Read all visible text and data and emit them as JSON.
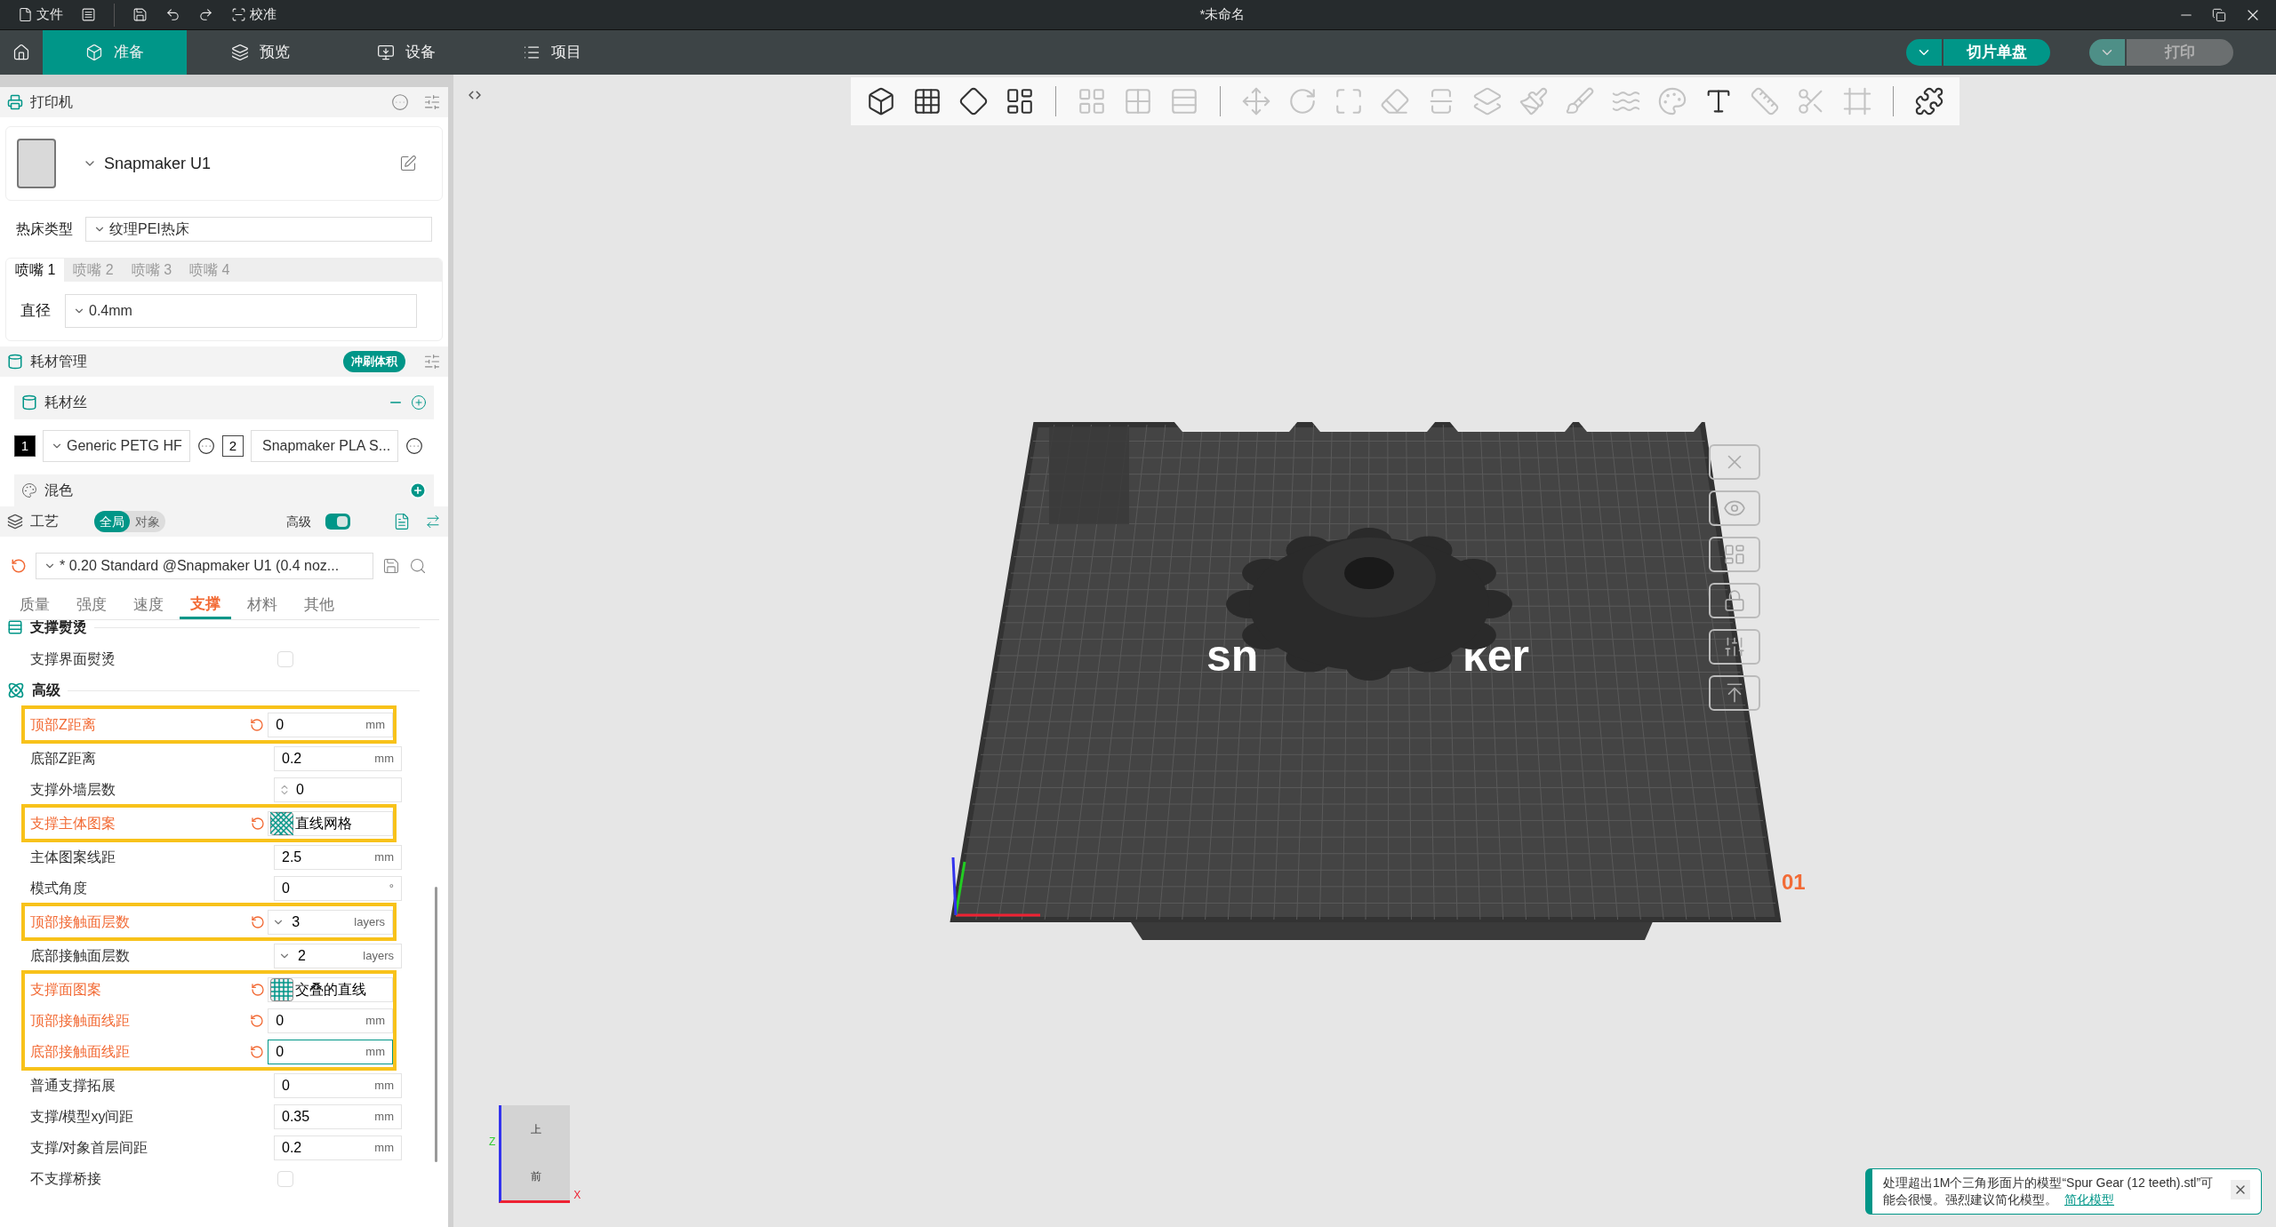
{
  "window": {
    "title": "*未命名",
    "menu": [
      {
        "kind": "file",
        "label": "文件"
      },
      {
        "kind": "menu"
      },
      {
        "kind": "save"
      },
      {
        "kind": "undo"
      },
      {
        "kind": "redo"
      },
      {
        "kind": "calibrate",
        "label": "校准"
      }
    ]
  },
  "tabs": [
    {
      "kind": "home",
      "selected": false
    },
    {
      "kind": "prepare",
      "label": "准备",
      "selected": true
    },
    {
      "kind": "preview",
      "label": "预览",
      "selected": false
    },
    {
      "kind": "device",
      "label": "设备",
      "selected": false
    },
    {
      "kind": "project",
      "label": "项目",
      "selected": false
    }
  ],
  "actions": [
    {
      "label": "切片单盘",
      "disabled": false
    },
    {
      "label": "打印",
      "disabled": true
    }
  ],
  "printer": {
    "title": "打印机",
    "name": "Snapmaker U1",
    "bed_label": "热床类型",
    "bed_value": "纹理PEI热床",
    "nozzles": [
      {
        "label": "喷嘴 1",
        "selected": true
      },
      {
        "label": "喷嘴 2",
        "selected": false
      },
      {
        "label": "喷嘴 3",
        "selected": false
      },
      {
        "label": "喷嘴 4",
        "selected": false
      }
    ],
    "diameter_label": "直径",
    "diameter_value": "0.4mm"
  },
  "filament": {
    "title": "耗材管理",
    "badge": "冲刷体积",
    "list_title": "耗材丝",
    "slots": [
      {
        "number": "1",
        "color": "#000000",
        "name": "Generic PETG HF"
      },
      {
        "number": "2",
        "color": "#ffffff",
        "name": "Snapmaker PLA S..."
      }
    ],
    "mix_title": "混色"
  },
  "process": {
    "title": "工艺",
    "scope": [
      {
        "label": "全局",
        "selected": true
      },
      {
        "label": "对象",
        "selected": false
      }
    ],
    "advanced_label": "高级",
    "advanced_on": true,
    "preset": "* 0.20 Standard @Snapmaker U1 (0.4 noz...",
    "tabs": [
      {
        "label": "质量",
        "selected": false
      },
      {
        "label": "强度",
        "selected": false
      },
      {
        "label": "速度",
        "selected": false
      },
      {
        "label": "支撑",
        "selected": true
      },
      {
        "label": "材料",
        "selected": false
      },
      {
        "label": "其他",
        "selected": false
      }
    ]
  },
  "settings": [
    {
      "kind": "section",
      "label": "支撑熨烫"
    },
    {
      "kind": "checkbox",
      "label": "支撑界面熨烫",
      "checked": false,
      "modified": false
    },
    {
      "kind": "section",
      "label": "高级"
    },
    {
      "kind": "group",
      "rows": [
        {
          "kind": "number",
          "label": "顶部Z距离",
          "value": "0",
          "unit": "mm",
          "modified": true,
          "focused": false
        }
      ]
    },
    {
      "kind": "number",
      "label": "底部Z距离",
      "value": "0.2",
      "unit": "mm",
      "modified": false,
      "focused": false
    },
    {
      "kind": "spin",
      "label": "支撑外墙层数",
      "value": "0",
      "modified": false
    },
    {
      "kind": "group",
      "rows": [
        {
          "kind": "crosspattern",
          "label": "支撑主体图案",
          "value": "直线网格",
          "modified": true
        }
      ]
    },
    {
      "kind": "number",
      "label": "主体图案线距",
      "value": "2.5",
      "unit": "mm",
      "modified": false,
      "focused": false
    },
    {
      "kind": "number",
      "label": "模式角度",
      "value": "0",
      "unit": "°",
      "modified": false,
      "focused": false
    },
    {
      "kind": "group",
      "rows": [
        {
          "kind": "dropdown",
          "label": "顶部接触面层数",
          "value": "3",
          "unit": "layers",
          "modified": true
        }
      ]
    },
    {
      "kind": "dropdown",
      "label": "底部接触面层数",
      "value": "2",
      "unit": "layers",
      "modified": false
    },
    {
      "kind": "group",
      "rows": [
        {
          "kind": "gridpattern",
          "label": "支撑面图案",
          "value": "交叠的直线",
          "modified": true
        },
        {
          "kind": "number",
          "label": "顶部接触面线距",
          "value": "0",
          "unit": "mm",
          "modified": true,
          "focused": false
        },
        {
          "kind": "number",
          "label": "底部接触面线距",
          "value": "0",
          "unit": "mm",
          "modified": true,
          "focused": true
        }
      ]
    },
    {
      "kind": "number",
      "label": "普通支撑拓展",
      "value": "0",
      "unit": "mm",
      "modified": false,
      "focused": false
    },
    {
      "kind": "number",
      "label": "支撑/模型xy间距",
      "value": "0.35",
      "unit": "mm",
      "modified": false,
      "focused": false
    },
    {
      "kind": "number",
      "label": "支撑/对象首层间距",
      "value": "0.2",
      "unit": "mm",
      "modified": false,
      "focused": false
    },
    {
      "kind": "checkbox",
      "label": "不支撑桥接",
      "checked": false,
      "modified": false
    }
  ],
  "toolbar": [
    {
      "kind": "cube",
      "disabled": false
    },
    {
      "kind": "plate",
      "disabled": false
    },
    {
      "kind": "orient",
      "disabled": false
    },
    {
      "kind": "arrange",
      "disabled": false
    },
    {
      "kind": "sep"
    },
    {
      "kind": "split-objects",
      "disabled": true
    },
    {
      "kind": "split-parts",
      "disabled": true
    },
    {
      "kind": "layers",
      "disabled": true
    },
    {
      "kind": "sep"
    },
    {
      "kind": "move",
      "disabled": true
    },
    {
      "kind": "rotate",
      "disabled": true
    },
    {
      "kind": "scale",
      "disabled": true
    },
    {
      "kind": "lay-flat",
      "disabled": true
    },
    {
      "kind": "cut",
      "disabled": true
    },
    {
      "kind": "boolean",
      "disabled": true
    },
    {
      "kind": "support-paint",
      "disabled": true
    },
    {
      "kind": "seam-paint",
      "disabled": true
    },
    {
      "kind": "fuzzy-paint",
      "disabled": true
    },
    {
      "kind": "color-paint",
      "disabled": true
    },
    {
      "kind": "text",
      "disabled": false
    },
    {
      "kind": "measure",
      "disabled": true
    },
    {
      "kind": "assemble",
      "disabled": true
    },
    {
      "kind": "frame",
      "disabled": true
    },
    {
      "kind": "sep"
    },
    {
      "kind": "puzzle",
      "disabled": false
    }
  ],
  "plate_tools": [
    {
      "kind": "close"
    },
    {
      "kind": "orient"
    },
    {
      "kind": "arrange"
    },
    {
      "kind": "lock"
    },
    {
      "kind": "settings"
    },
    {
      "kind": "top"
    }
  ],
  "viewport": {
    "logo_left": "sn",
    "logo_right": "ker",
    "plate_number": "01",
    "cube_top": "上",
    "cube_front": "前",
    "axis_z": "Z",
    "axis_x": "X"
  },
  "notification": {
    "text": "处理超出1M个三角形面片的模型“Spur Gear (12 teeth).stl”可能会很慢。强烈建议简化模型。",
    "link": "简化模型"
  }
}
